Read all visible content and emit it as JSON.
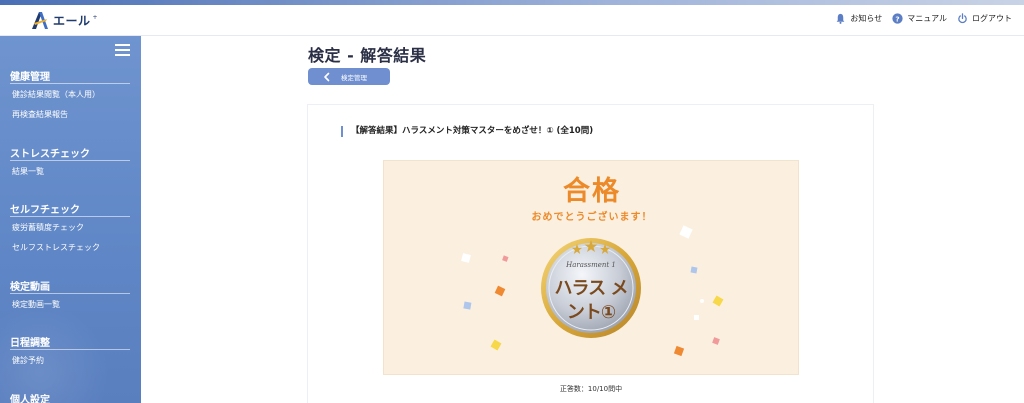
{
  "header": {
    "logo_text": "エール",
    "notice_label": "お知らせ",
    "manual_label": "マニュアル",
    "logout_label": "ログアウト"
  },
  "sidebar": {
    "sections": [
      {
        "title": "健康管理",
        "items": [
          "健診結果閲覧（本人用）",
          "再検査結果報告"
        ]
      },
      {
        "title": "ストレスチェック",
        "items": [
          "結果一覧"
        ]
      },
      {
        "title": "セルフチェック",
        "items": [
          "疲労蓄積度チェック",
          "セルフストレスチェック"
        ]
      },
      {
        "title": "検定動画",
        "items": [
          "検定動画一覧"
        ]
      },
      {
        "title": "日程調整",
        "items": [
          "健診予約"
        ]
      },
      {
        "title": "個人設定",
        "items": []
      }
    ]
  },
  "main": {
    "title": "検定 - 解答結果",
    "back_label": "検定管理",
    "result_heading": "【解答結果】ハラスメント対策マスターをめざせ！① (全10問)",
    "pass_text": "合格",
    "congrats_text": "おめでとうございます！",
    "badge": {
      "subtitle": "Harassment 1",
      "line1": "ハラス メ",
      "line2": "ント①"
    },
    "score_text": "正答数：10/10問中"
  },
  "colors": {
    "accent": "#6f8fd0",
    "sidebar": "#6a8fcc",
    "pass_orange": "#ec8a2a",
    "result_bg": "#fbf0e0"
  }
}
